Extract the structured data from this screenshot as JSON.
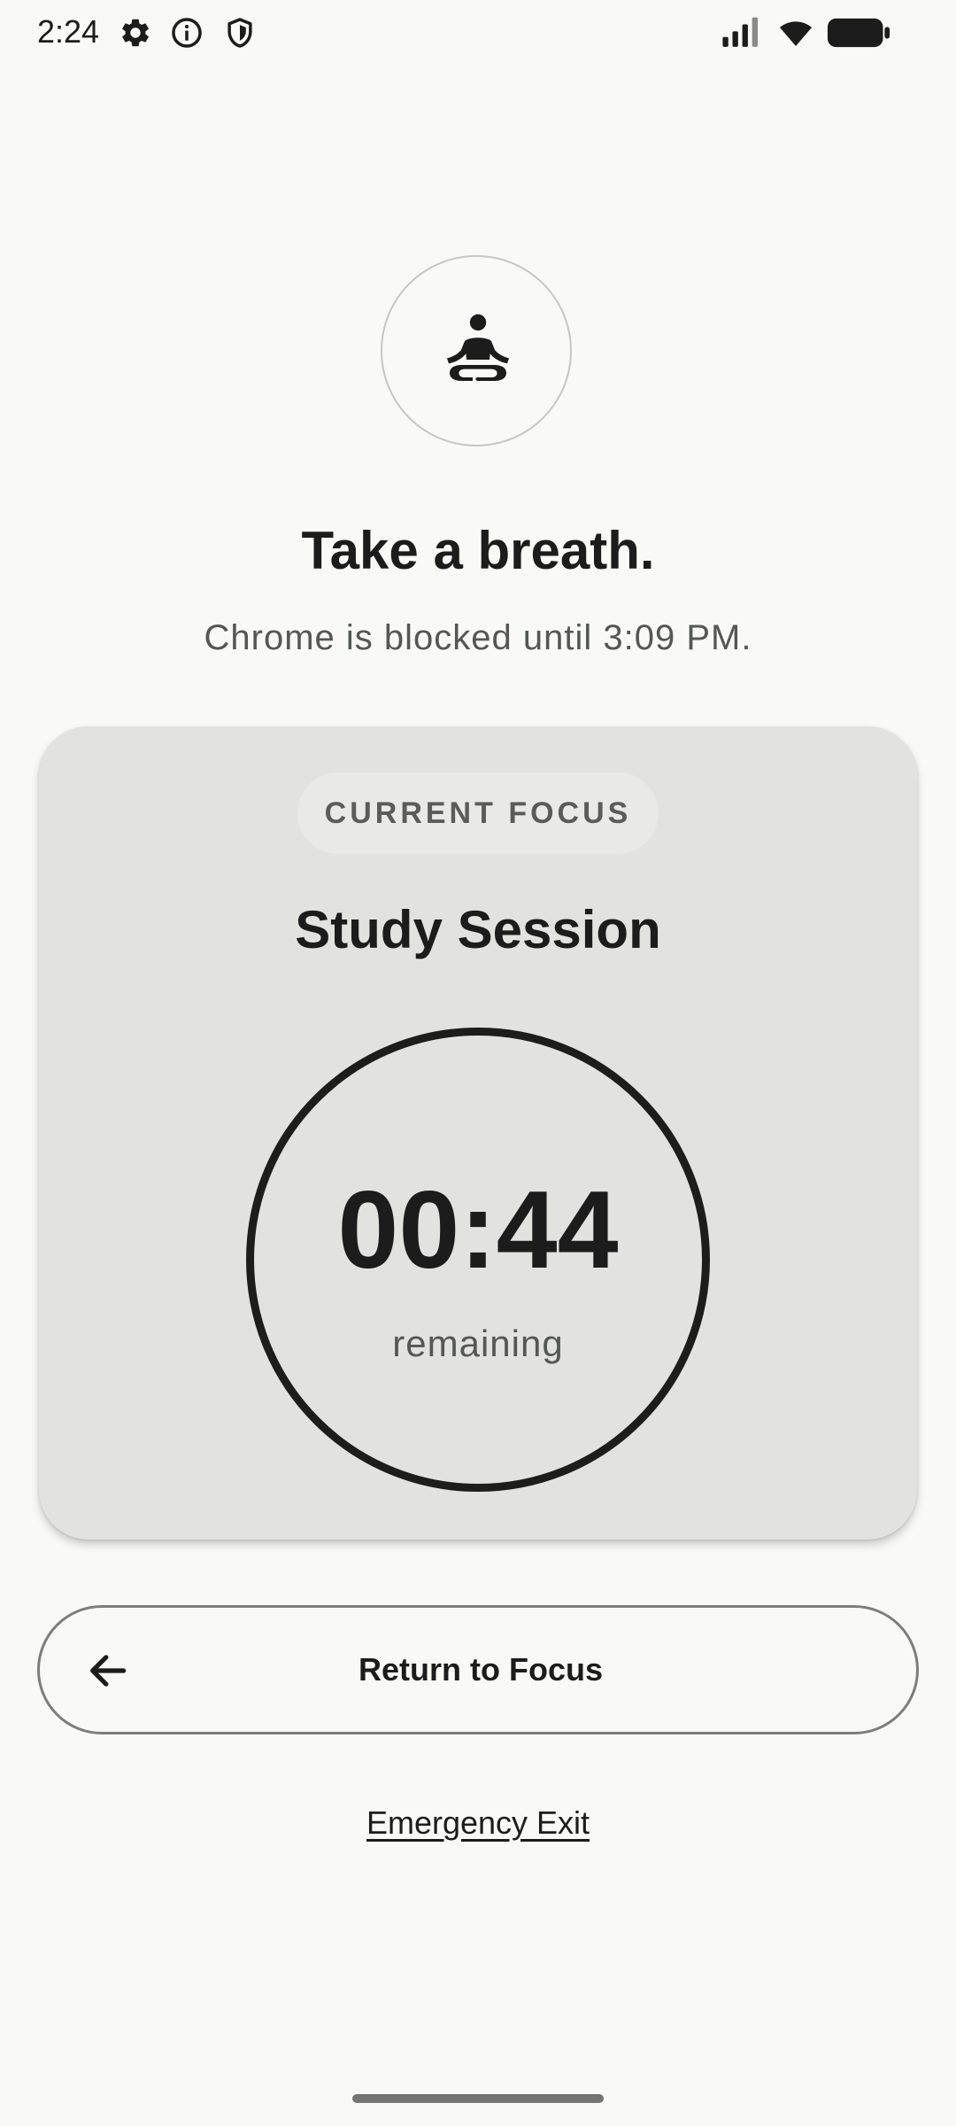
{
  "status_bar": {
    "time": "2:24",
    "left_icons": [
      "gear-icon",
      "info-icon",
      "shield-icon"
    ],
    "right_icons": [
      "cellular-signal-icon",
      "wifi-icon",
      "battery-icon"
    ]
  },
  "header": {
    "icon": "meditation-icon",
    "title": "Take a breath.",
    "subtitle": "Chrome is blocked until 3:09 PM."
  },
  "focus_card": {
    "chip_label": "CURRENT FOCUS",
    "session_name": "Study Session",
    "timer_value": "00:44",
    "timer_label": "remaining"
  },
  "actions": {
    "return_label": "Return to Focus",
    "return_icon": "arrow-left-icon",
    "emergency_exit_label": "Emergency Exit"
  },
  "colors": {
    "background": "#f9f9f7",
    "card": "#e2e2e1",
    "text_primary": "#1b1c1b",
    "text_secondary": "#555754"
  }
}
